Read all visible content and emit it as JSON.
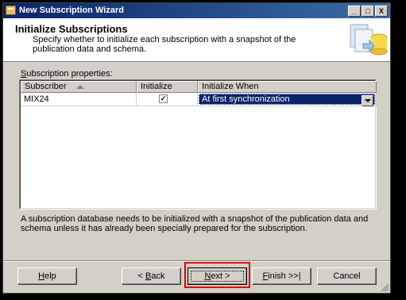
{
  "window": {
    "title": "New Subscription Wizard",
    "minimize_glyph": "_",
    "maximize_glyph": "□",
    "close_glyph": "X"
  },
  "header": {
    "title": "Initialize Subscriptions",
    "description": "Specify whether to initialize each subscription with a snapshot of the publication data and schema."
  },
  "properties": {
    "label_prefix": "S",
    "label_rest": "ubscription properties:"
  },
  "grid": {
    "columns": [
      "Subscriber",
      "Initialize",
      "Initialize When"
    ],
    "rows": [
      {
        "subscriber": "MIX24",
        "initialize": true,
        "check_glyph": "✓",
        "initialize_when": "At first synchronization"
      }
    ]
  },
  "note": "A subscription database needs to be initialized with a snapshot of the publication data and schema unless it has already been specially prepared for the subscription.",
  "buttons": {
    "help": {
      "underline": "H",
      "rest": "elp"
    },
    "back": {
      "pre": "< ",
      "underline": "B",
      "rest": "ack"
    },
    "next": {
      "underline": "N",
      "rest": "ext >"
    },
    "finish": {
      "underline": "F",
      "rest": "inish >>|"
    },
    "cancel": "Cancel"
  }
}
